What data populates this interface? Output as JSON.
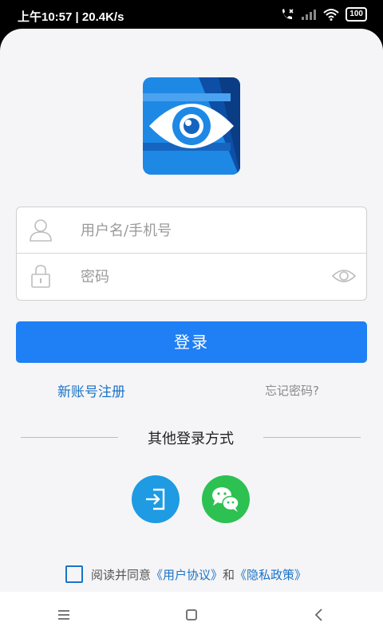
{
  "status_bar": {
    "time": "上午10:57 | 20.4K/s",
    "battery": "100"
  },
  "login": {
    "username_placeholder": "用户名/手机号",
    "password_placeholder": "密码",
    "login_label": "登录",
    "register_label": "新账号注册",
    "forgot_label": "忘记密码?",
    "other_methods_label": "其他登录方式"
  },
  "other_login": [
    {
      "icon": "login-door-icon",
      "color": "#1e9be2"
    },
    {
      "icon": "wechat-icon",
      "color": "#2dc151"
    }
  ],
  "agreement": {
    "prefix": "阅读并同意",
    "user_agreement": "《用户协议》",
    "and": "和",
    "privacy_policy": "《隐私政策》"
  },
  "colors": {
    "primary": "#1f7ff5",
    "link": "#1a73c7"
  }
}
